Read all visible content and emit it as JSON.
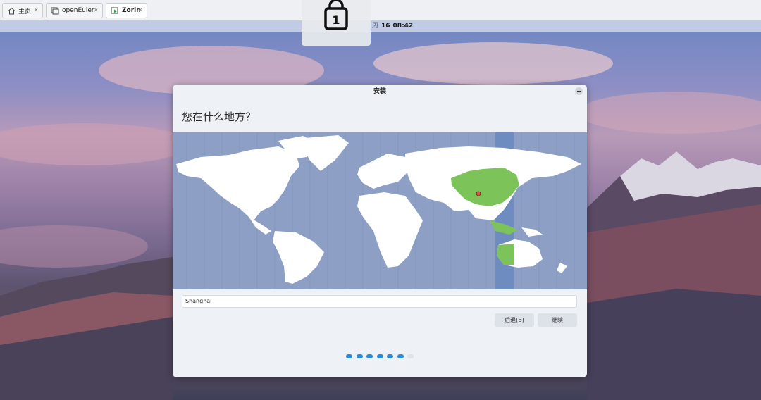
{
  "host_tabs": [
    {
      "label": "主页",
      "icon": "home-icon",
      "active": false
    },
    {
      "label": "openEuler",
      "icon": "vm-icon",
      "active": false
    },
    {
      "label": "Zorin",
      "icon": "vm-running-icon",
      "active": true
    }
  ],
  "lock_overlay": {
    "number": "1",
    "icon": "lock-icon"
  },
  "top_panel": {
    "day": "周",
    "date": "16",
    "time": "08:42"
  },
  "window": {
    "title": "安装",
    "question": "您在什么地方？",
    "timezone_value": "Shanghai",
    "back_label": "后退(B)",
    "next_label": "继续",
    "progress": {
      "total": 7,
      "completed": 6
    }
  },
  "colors": {
    "accent": "#2b8bd6",
    "map_ocean": "#8d9fc4",
    "map_land": "#ffffff",
    "map_highlight": "#7cc35a",
    "map_timezone_band": "#6f8cc0",
    "window_bg": "#eef1f6"
  }
}
